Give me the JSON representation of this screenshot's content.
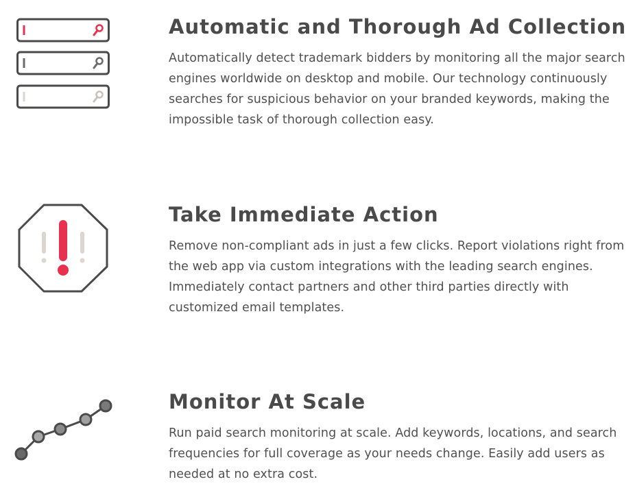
{
  "features": [
    {
      "title": "Automatic and Thorough Ad Collection",
      "body": "Automatically detect trademark bidders by monitoring all the major search engines worldwide on desktop and mobile. Our technology continuously searches for suspicious behavior on your branded keywords, making the impossible task of thorough collection easy.",
      "icon": "search-bars-icon"
    },
    {
      "title": "Take Immediate Action",
      "body": "Remove non-compliant ads in just a few clicks. Report violations right from the web app via custom integrations with the leading search engines. Immediately contact partners and other third parties directly with customized email templates.",
      "icon": "alert-octagon-icon"
    },
    {
      "title": "Monitor At Scale",
      "body": "Run paid search monitoring at scale. Add keywords, locations, and search frequencies for full coverage as your needs change. Easily add users as needed at no extra cost.",
      "icon": "growth-line-icon"
    }
  ],
  "colors": {
    "accent": "#e8304f",
    "outline": "#4a4a4a",
    "muted": "#dcd6d0",
    "dot_fill": "#9a9a9a"
  }
}
